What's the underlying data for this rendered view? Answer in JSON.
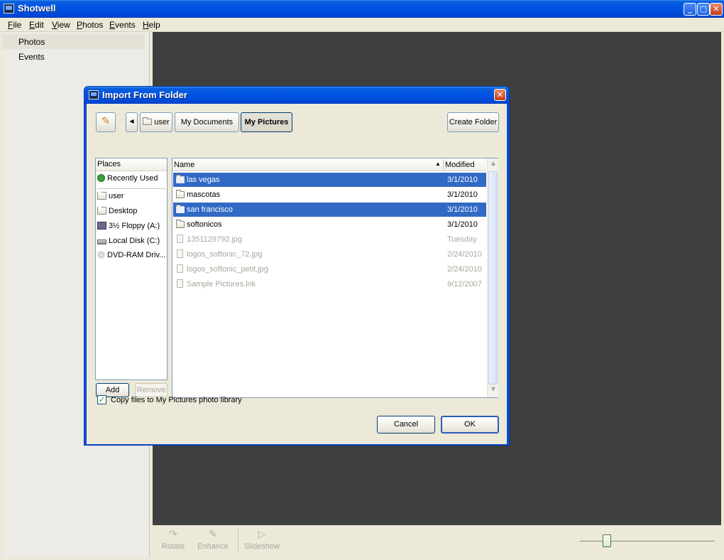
{
  "app": {
    "title": "Shotwell",
    "menu": [
      "File",
      "Edit",
      "View",
      "Photos",
      "Events",
      "Help"
    ]
  },
  "sidebar": {
    "items": [
      {
        "label": "Photos"
      },
      {
        "label": "Events"
      }
    ]
  },
  "toolbar": {
    "rotate_label": "Rotate",
    "enhance_label": "Enhance",
    "slideshow_label": "Slideshow"
  },
  "dialog": {
    "title": "Import From Folder",
    "path_buttons": [
      "user",
      "My Documents",
      "My Pictures"
    ],
    "create_folder_label": "Create Folder",
    "places_header": "Places",
    "places": [
      {
        "label": "Recently Used",
        "icon": "recently-used-icon"
      },
      {
        "label": "user",
        "icon": "folder-icon"
      },
      {
        "label": "Desktop",
        "icon": "folder-icon"
      },
      {
        "label": "3½ Floppy (A:)",
        "icon": "floppy-icon"
      },
      {
        "label": "Local Disk (C:)",
        "icon": "hard-disk-icon"
      },
      {
        "label": "DVD-RAM Driv...",
        "icon": "dvd-drive-icon"
      }
    ],
    "add_label": "Add",
    "remove_label": "Remove",
    "columns": {
      "name": "Name",
      "modified": "Modified"
    },
    "files": [
      {
        "name": "las vegas",
        "modified": "3/1/2010",
        "type": "folder",
        "selected": true
      },
      {
        "name": "mascotas",
        "modified": "3/1/2010",
        "type": "folder",
        "selected": false
      },
      {
        "name": "san francisco",
        "modified": "3/1/2010",
        "type": "folder",
        "selected": true
      },
      {
        "name": "softonicos",
        "modified": "3/1/2010",
        "type": "folder",
        "selected": false
      },
      {
        "name": "1351129792.jpg",
        "modified": "Tuesday",
        "type": "file",
        "selected": false
      },
      {
        "name": "logos_softonic_72.jpg",
        "modified": "2/24/2010",
        "type": "file",
        "selected": false
      },
      {
        "name": "logos_softonic_petit.jpg",
        "modified": "2/24/2010",
        "type": "file",
        "selected": false
      },
      {
        "name": "Sample Pictures.lnk",
        "modified": "9/12/2007",
        "type": "file",
        "selected": false
      }
    ],
    "copy_checkbox_label": "Copy files to My Pictures photo library",
    "copy_checked": true,
    "cancel_label": "Cancel",
    "ok_label": "OK"
  },
  "colors": {
    "titlebar": "#0055e5",
    "selection": "#316ac5",
    "viewer_bg": "#3f3f3f"
  }
}
